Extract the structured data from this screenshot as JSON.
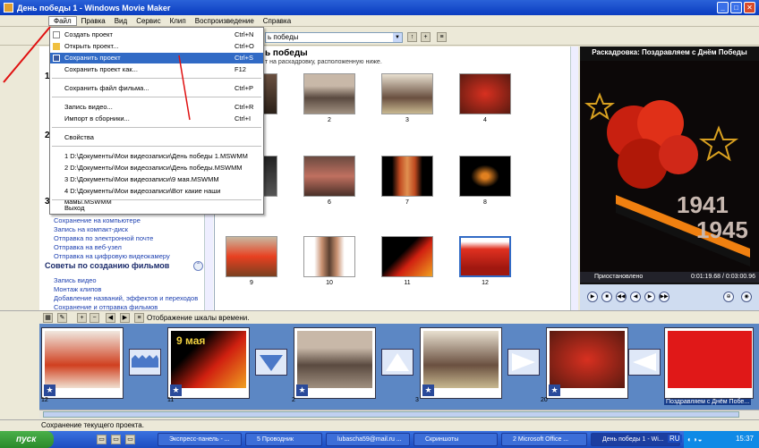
{
  "window": {
    "title": "День победы 1 - Windows Movie Maker",
    "min": "_",
    "max": "□",
    "close": "✕"
  },
  "menubar": [
    "Файл",
    "Правка",
    "Вид",
    "Сервис",
    "Клип",
    "Воспроизведение",
    "Справка"
  ],
  "toolbar": {
    "collection": "ь победы"
  },
  "file_menu": [
    {
      "label": "Создать проект",
      "shortcut": "Ctrl+N"
    },
    {
      "label": "Открыть проект...",
      "shortcut": "Ctrl+O"
    },
    {
      "label": "Сохранить проект",
      "shortcut": "Ctrl+S",
      "highlight": true
    },
    {
      "label": "Сохранить проект как...",
      "shortcut": "F12"
    },
    {
      "label": "Сохранить файл фильма...",
      "shortcut": "Ctrl+P"
    },
    {
      "label": "Запись видео...",
      "shortcut": "Ctrl+R"
    },
    {
      "label": "Импорт в сборники...",
      "shortcut": "Ctrl+I"
    },
    {
      "label": "Свойства",
      "shortcut": ""
    },
    {
      "label": "1 D:\\Документы\\Мои видеозаписи\\День победы 1.MSWMM",
      "shortcut": ""
    },
    {
      "label": "2 D:\\Документы\\Мои видеозаписи\\День победы.MSWMM",
      "shortcut": ""
    },
    {
      "label": "3 D:\\Документы\\Мои видеозаписи\\9 мая.MSWMM",
      "shortcut": ""
    },
    {
      "label": "4 D:\\Документы\\Мои видеозаписи\\Вот какие наши мамы.MSWMM",
      "shortcut": ""
    },
    {
      "label": "Выход",
      "shortcut": ""
    }
  ],
  "taskpane": {
    "side_numbers": [
      "1",
      "2",
      "3"
    ],
    "links": [
      "Сохранение на компьютере",
      "Запись на компакт-диск",
      "Отправка по электронной почте",
      "Отправка на веб-узел",
      "Отправка на цифровую видеокамеру"
    ],
    "tips_header": "Советы по созданию фильмов",
    "tips_toggle": "⌃",
    "tips": [
      "Запись видео",
      "Монтаж клипов",
      "Добавление названий, эффектов и переходов",
      "Сохранение и отправка фильмов"
    ]
  },
  "content": {
    "title": "ь победы",
    "subtitle": "т на раскадровку, расположенную ниже.",
    "clip_numbers": [
      "1",
      "2",
      "3",
      "4",
      "5",
      "6",
      "7",
      "8",
      "9",
      "10",
      "11",
      "12"
    ]
  },
  "monitor": {
    "title": "Раскадровка: Поздравляем с Днём Победы",
    "year1": "1941",
    "year2": "1945",
    "status": "Приостановлено",
    "time": "0:01:19.68 / 0:03:00.96"
  },
  "storyboard": {
    "toolbar_label": "Отображение шкалы времени.",
    "clip_numbers": [
      "12",
      "11",
      "2",
      "3",
      "20"
    ],
    "selected_label": "Поздравляем с Днём Побе...",
    "card1_text": "9 мая"
  },
  "statusbar": "Сохранение текущего проекта.",
  "taskbar": {
    "start": "пуск",
    "buttons": [
      "Экспресс-панель - ...",
      "5 Проводник",
      "lubascha59@mail.ru ...",
      "Скриншоты",
      "2 Microsoft Office ...",
      "День победы 1 - Wi..."
    ],
    "lang": "RU",
    "clock": "15:37"
  }
}
